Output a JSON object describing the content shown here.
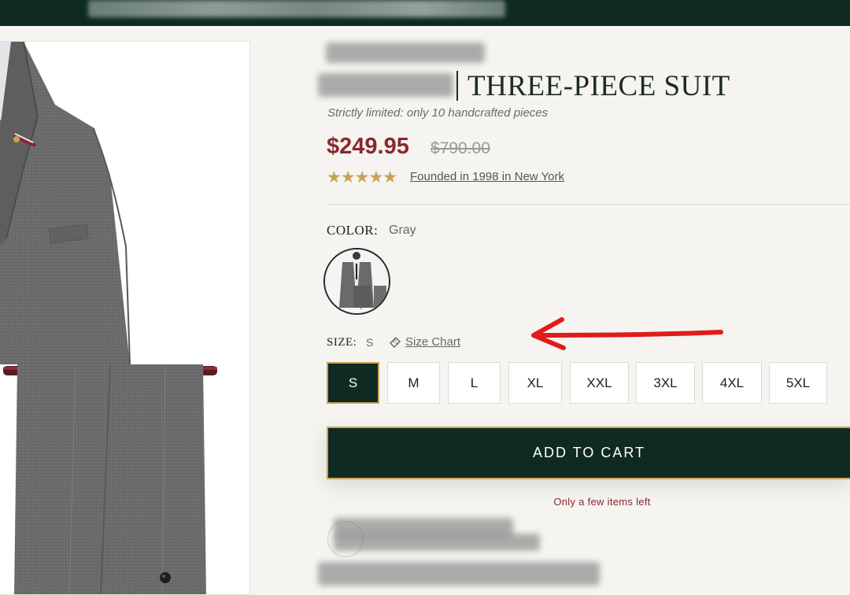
{
  "product": {
    "title": "THREE-PIECE SUIT",
    "tagline": "Strictly limited: only 10 handcrafted pieces",
    "price": "$249.95",
    "compare_price": "$790.00",
    "rating_stars": "★★★★★",
    "founded_link": "Founded in 1998 in New York"
  },
  "color": {
    "label": "COLOR:",
    "selected": "Gray",
    "swatch_icon": "gray-suit-thumbnail"
  },
  "size": {
    "label": "SIZE:",
    "selected": "S",
    "chart_link": "Size Chart",
    "options": [
      "S",
      "M",
      "L",
      "XL",
      "XXL",
      "3XL",
      "4XL",
      "5XL"
    ]
  },
  "cart": {
    "button_label": "ADD TO CART",
    "stock_note": "Only a few items left"
  },
  "colors": {
    "header_bg": "#0e2a22",
    "accent_gold": "#c7a355",
    "price_red": "#8a2730",
    "arrow_red": "#e01b1b"
  }
}
